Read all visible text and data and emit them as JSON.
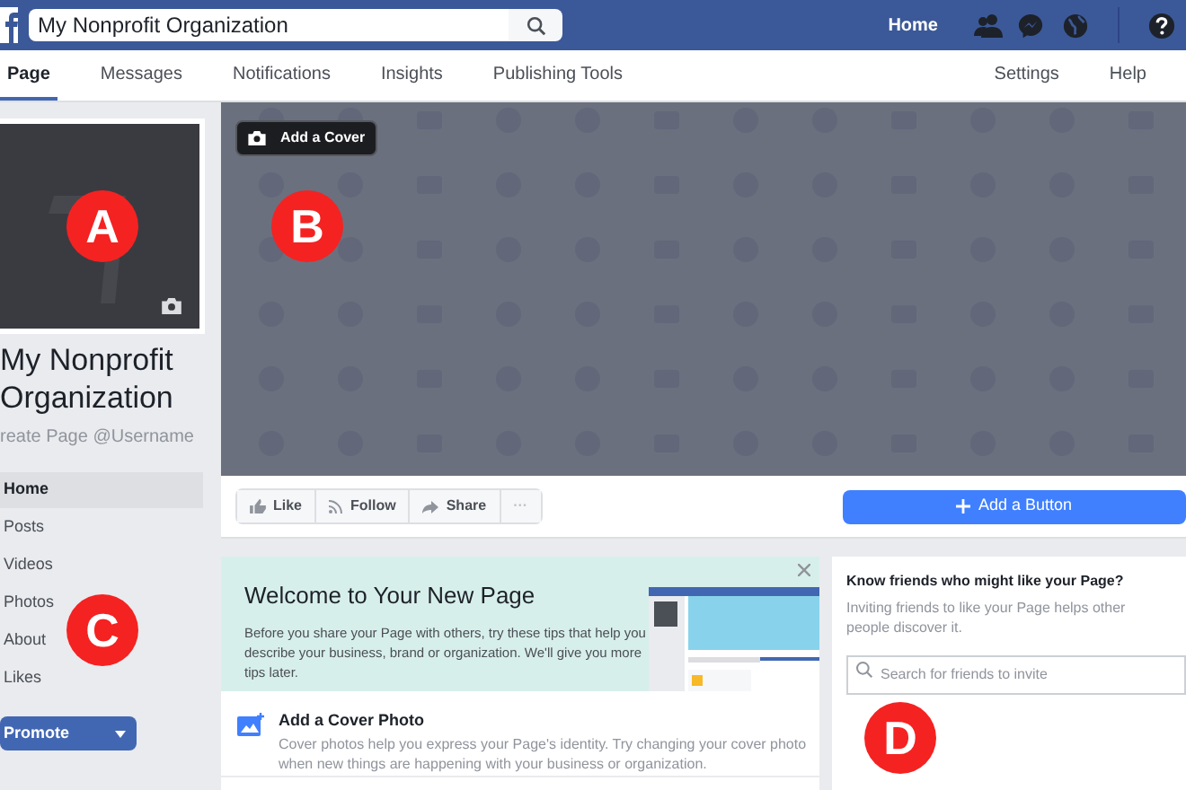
{
  "top_bar": {
    "search": {
      "value": "My Nonprofit Organization"
    },
    "home": "Home"
  },
  "tabs": [
    {
      "label": "Page",
      "selected": true
    },
    {
      "label": "Messages",
      "selected": false
    },
    {
      "label": "Notifications",
      "selected": false
    },
    {
      "label": "Insights",
      "selected": false
    },
    {
      "label": "Publishing Tools",
      "selected": false
    },
    {
      "label": "Settings",
      "selected": false
    },
    {
      "label": "Help",
      "selected": false
    }
  ],
  "page": {
    "name": "My Nonprofit Organization",
    "username": "reate Page @Username"
  },
  "nav": [
    {
      "label": "Home",
      "selected": true
    },
    {
      "label": "Posts",
      "selected": false
    },
    {
      "label": "Videos",
      "selected": false
    },
    {
      "label": "Photos",
      "selected": false
    },
    {
      "label": "About",
      "selected": false
    },
    {
      "label": "Likes",
      "selected": false
    }
  ],
  "promote": "Promote",
  "cover_button": "Add a Cover",
  "actions": [
    {
      "kind": "like",
      "label": "Like"
    },
    {
      "kind": "follow",
      "label": "Follow"
    },
    {
      "kind": "share",
      "label": "Share"
    },
    {
      "kind": "more",
      "label": "···"
    }
  ],
  "add_button": "Add a Button",
  "welcome": {
    "title": "Welcome to Your New Page",
    "text": "Before you share your Page with others, try these tips that help you describe your business, brand or organization. We'll give you more tips later."
  },
  "tip": {
    "title": "Add a Cover Photo",
    "text": "Cover photos help you express your Page's identity. Try changing your cover photo when new things are happening with your business or organization."
  },
  "invite": {
    "title": "Know friends who might like your Page?",
    "text": "Inviting friends to like your Page helps other people discover it.",
    "search": {
      "placeholder": "Search for friends to invite"
    }
  },
  "markers": [
    {
      "label": "A"
    },
    {
      "label": "B"
    },
    {
      "label": "C"
    },
    {
      "label": "D"
    }
  ]
}
